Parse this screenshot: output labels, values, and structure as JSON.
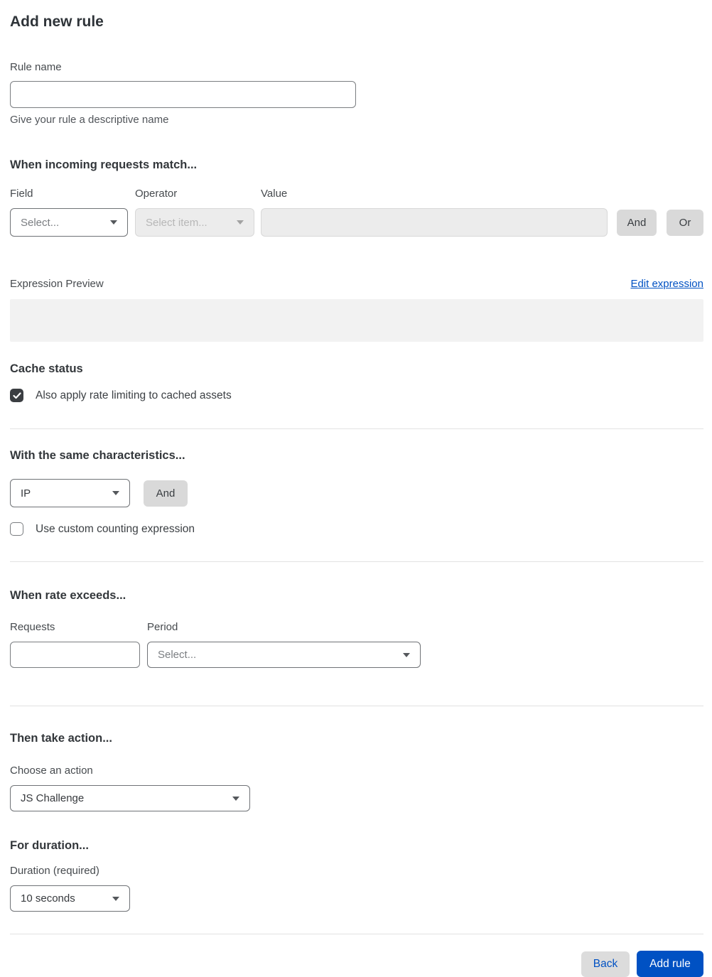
{
  "page": {
    "title": "Add new rule"
  },
  "rule_name": {
    "label": "Rule name",
    "value": "",
    "helper": "Give your rule a descriptive name"
  },
  "match_section": {
    "heading": "When incoming requests match...",
    "field_label": "Field",
    "field_value": "Select...",
    "operator_label": "Operator",
    "operator_value": "Select item...",
    "operator_disabled": true,
    "value_label": "Value",
    "value_value": "",
    "value_disabled": true,
    "and_label": "And",
    "or_label": "Or"
  },
  "expression": {
    "label": "Expression Preview",
    "edit_link": "Edit expression",
    "preview_content": ""
  },
  "cache_status": {
    "heading": "Cache status",
    "checkbox_label": "Also apply rate limiting to cached assets",
    "checked": true
  },
  "characteristics": {
    "heading": "With the same characteristics...",
    "select_value": "IP",
    "and_label": "And",
    "checkbox_label": "Use custom counting expression",
    "checked": false
  },
  "rate": {
    "heading": "When rate exceeds...",
    "requests_label": "Requests",
    "requests_value": "",
    "period_label": "Period",
    "period_value": "Select..."
  },
  "action": {
    "heading": "Then take action...",
    "label": "Choose an action",
    "value": "JS Challenge"
  },
  "duration": {
    "heading": "For duration...",
    "label": "Duration (required)",
    "value": "10 seconds"
  },
  "footer": {
    "back_label": "Back",
    "add_label": "Add rule"
  },
  "colors": {
    "accent_blue": "#0051c3",
    "button_gray": "#d9d9d9",
    "disabled_bg": "#ececec",
    "preview_bg": "#f2f2f2",
    "checkbox_checked": "#3b3e42"
  }
}
